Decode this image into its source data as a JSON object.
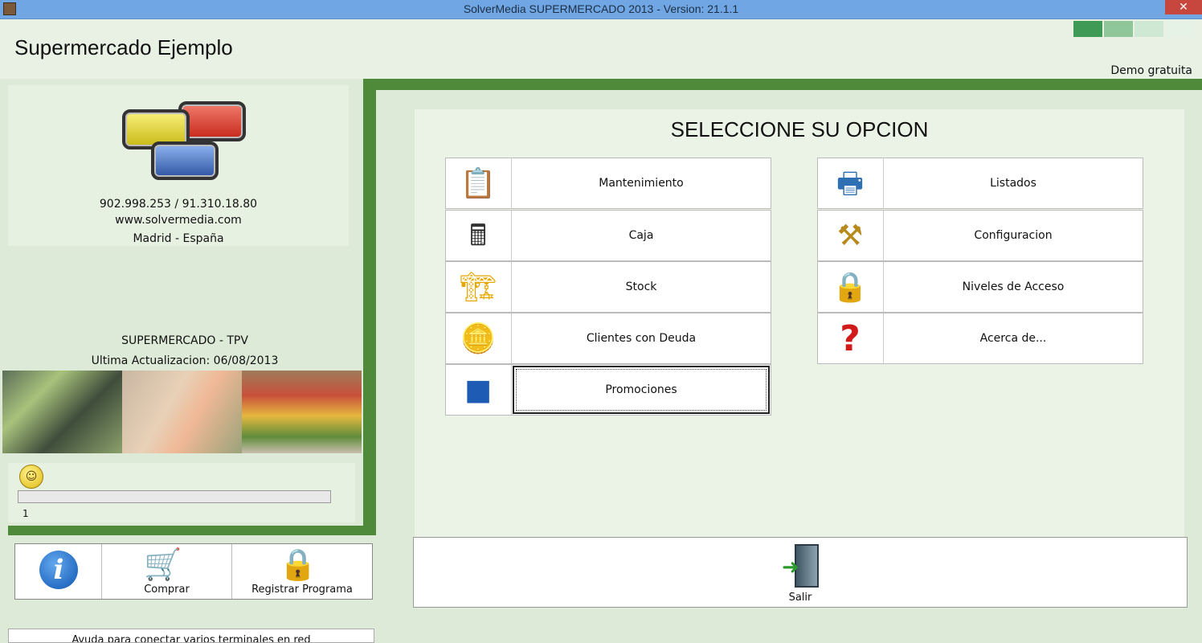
{
  "window": {
    "title": "SolverMedia SUPERMERCADO 2013  -  Version: 21.1.1",
    "close_label": "✕"
  },
  "header": {
    "company_name": "Supermercado Ejemplo",
    "license": "Demo gratuita",
    "status_colors": [
      "#3f9a55",
      "#8fc79a",
      "#cfe8d3",
      "#e6f2e6"
    ]
  },
  "contact": {
    "phone": "902.998.253 / 91.310.18.80",
    "web": "www.solvermedia.com",
    "city": "Madrid - España"
  },
  "app": {
    "name": "SUPERMERCADO - TPV",
    "update": "Ultima Actualizacion: 06/08/2013"
  },
  "progress": {
    "value_label": "1",
    "fraction": 0
  },
  "toolbar": {
    "info_icon": "info-icon",
    "buy_label": "Comprar",
    "register_label": "Registrar Programa"
  },
  "help": {
    "text": "Ayuda para conectar varios terminales en red"
  },
  "menu": {
    "title": "SELECCIONE SU OPCION",
    "left": [
      {
        "label": "Mantenimiento",
        "icon": "form-icon"
      },
      {
        "label": "Caja",
        "icon": "calculator-icon"
      },
      {
        "label": "Stock",
        "icon": "forklift-icon"
      },
      {
        "label": "Clientes con Deuda",
        "icon": "coins-icon"
      },
      {
        "label": "Promociones",
        "icon": "promo-box-icon"
      }
    ],
    "right": [
      {
        "label": "Listados",
        "icon": "printer-icon"
      },
      {
        "label": "Configuracion",
        "icon": "tools-icon"
      },
      {
        "label": "Niveles de Acceso",
        "icon": "padlock-icon"
      },
      {
        "label": "Acerca de...",
        "icon": "question-icon"
      }
    ]
  },
  "exit": {
    "label": "Salir",
    "icon": "exit-door-icon"
  }
}
